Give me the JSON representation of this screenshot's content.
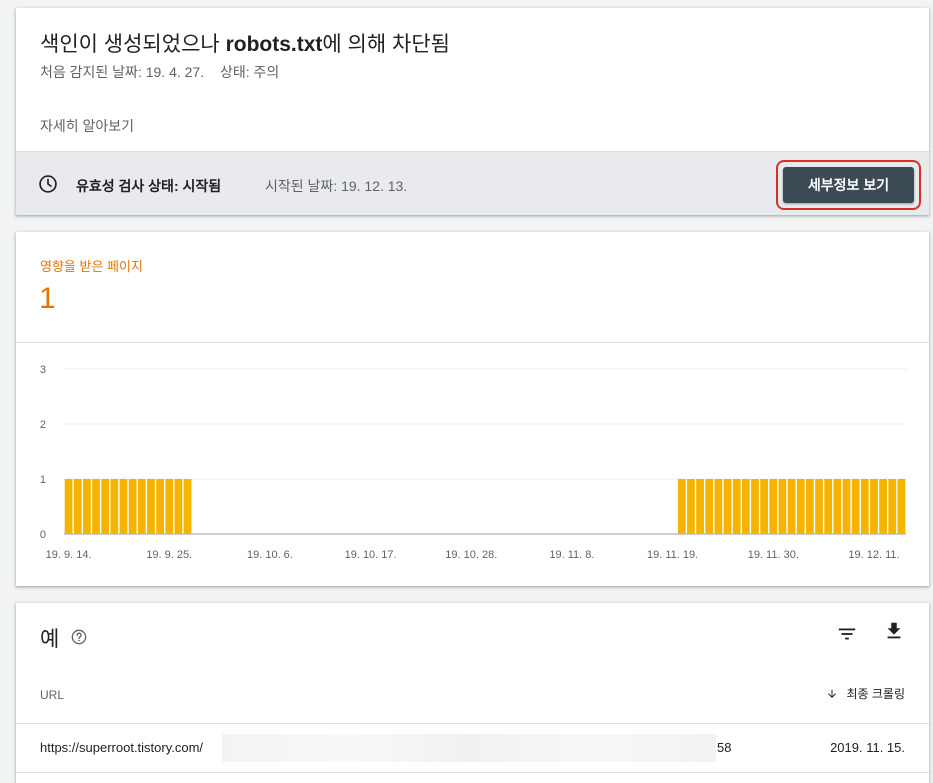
{
  "issue": {
    "title_prefix": "색인이 생성되었으나 ",
    "title_emphasis": "robots.txt",
    "title_suffix": "에 의해 차단됨",
    "first_detected": "처음 감지된 날짜: 19. 4. 27.",
    "status": "상태: 주의",
    "learn_more": "자세히 알아보기"
  },
  "validation": {
    "label": "유효성 검사 상태: 시작됨",
    "started": "시작된 날짜: 19. 12. 13.",
    "details_button": "세부정보 보기"
  },
  "summary": {
    "affected_label": "영향을 받은 페이지",
    "affected_count": "1"
  },
  "colors": {
    "accent": "#e37400",
    "bar": "#f4b400",
    "button": "#3c4a53",
    "highlight": "#d93025"
  },
  "chart_data": {
    "type": "bar",
    "y_ticks": [
      "0",
      "1",
      "2",
      "3"
    ],
    "ylim": [
      0,
      3
    ],
    "x_tick_labels": [
      "19. 9. 14.",
      "19. 9. 25.",
      "19. 10. 6.",
      "19. 10. 17.",
      "19. 10. 28.",
      "19. 11. 8.",
      "19. 11. 19.",
      "19. 11. 30.",
      "19. 12. 11."
    ],
    "x_start": "19. 9. 14.",
    "x_end": "19. 12. 11.",
    "series": [
      {
        "values": [
          1,
          1,
          1,
          1,
          1,
          1,
          1,
          1,
          1,
          1,
          1,
          1,
          1,
          1,
          0,
          0,
          0,
          0,
          0,
          0,
          0,
          0,
          0,
          0,
          0,
          0,
          0,
          0,
          0,
          0,
          0,
          0,
          0,
          0,
          0,
          0,
          0,
          0,
          0,
          0,
          0,
          0,
          0,
          0,
          0,
          0,
          0,
          0,
          0,
          0,
          0,
          0,
          0,
          0,
          0,
          0,
          0,
          0,
          0,
          0,
          0,
          0,
          0,
          0,
          0,
          0,
          0,
          1,
          1,
          1,
          1,
          1,
          1,
          1,
          1,
          1,
          1,
          1,
          1,
          1,
          1,
          1,
          1,
          1,
          1,
          1,
          1,
          1,
          1,
          1,
          1,
          1
        ]
      }
    ],
    "grid": true
  },
  "examples": {
    "title": "예",
    "col_url": "URL",
    "col_crawl": "최종 크롤링",
    "rows": [
      {
        "url_prefix": "https://superroot.tistory.com/",
        "url_suffix": "58",
        "last_crawled": "2019. 11. 15."
      }
    ]
  }
}
